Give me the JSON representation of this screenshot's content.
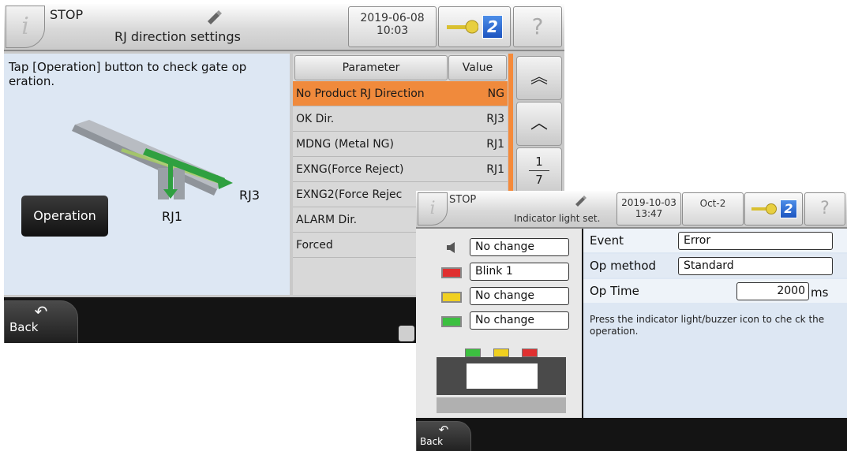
{
  "screenA": {
    "header": {
      "info_glyph": "i",
      "status": "STOP",
      "title": "RJ direction settings",
      "date": "2019-06-08",
      "time": "10:03",
      "user_level": "2",
      "help_glyph": "?"
    },
    "left": {
      "instruction": "Tap [Operation] button to check gate op eration.",
      "operation_label": "Operation",
      "rj1_label": "RJ1",
      "rj3_label": "RJ3"
    },
    "table": {
      "col_param": "Parameter",
      "col_value": "Value",
      "rows": [
        {
          "param": "No Product RJ Direction",
          "value": "NG"
        },
        {
          "param": "OK Dir.",
          "value": "RJ3"
        },
        {
          "param": "MDNG (Metal NG)",
          "value": "RJ1"
        },
        {
          "param": "EXNG(Force Reject)",
          "value": "RJ1"
        },
        {
          "param": "EXNG2(Force Rejec",
          "value": ""
        },
        {
          "param": "ALARM Dir.",
          "value": ""
        },
        {
          "param": "Forced",
          "value": ""
        }
      ]
    },
    "scroll": {
      "top_glyph": "︽",
      "up_glyph": "︿",
      "page_current": "1",
      "page_total": "7"
    },
    "footer": {
      "back_label": "Back",
      "back_glyph": "↶"
    },
    "colors": {
      "highlight": "#f08a3c",
      "panel": "#dde7f3",
      "rail": "#f58a3a"
    }
  },
  "screenB": {
    "header": {
      "info_glyph": "i",
      "status": "STOP",
      "title": "Indicator light set.",
      "date": "2019-10-03",
      "time": "13:47",
      "month": "Oct-2",
      "user_level": "2",
      "help_glyph": "?"
    },
    "lights": [
      {
        "icon": "buzzer-icon",
        "value": "No change"
      },
      {
        "icon": "red-light-icon",
        "value": "Blink 1"
      },
      {
        "icon": "yellow-light-icon",
        "value": "No change"
      },
      {
        "icon": "green-light-icon",
        "value": "No change"
      }
    ],
    "settings": {
      "event_label": "Event",
      "event_value": "Error",
      "method_label": "Op method",
      "method_value": "Standard",
      "optime_label": "Op Time",
      "optime_value": "2000",
      "optime_unit": "ms",
      "note": "Press the indicator light/buzzer icon to che ck the operation."
    },
    "footer": {
      "back_label": "Back",
      "back_glyph": "↶"
    },
    "colors": {
      "red": "#e03030",
      "yellow": "#f0d020",
      "green": "#3cc040"
    }
  }
}
